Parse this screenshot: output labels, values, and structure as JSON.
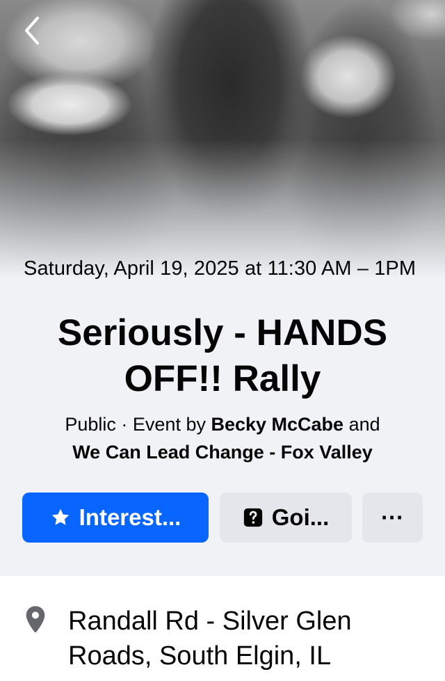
{
  "event": {
    "date_time": "Saturday, April 19, 2025 at 11:30 AM – 1PM",
    "title": "Seriously - HANDS OFF!! Rally",
    "privacy": "Public",
    "separator": " · ",
    "event_by_prefix": "Event by ",
    "host_1": "Becky McCabe",
    "and_word": " and ",
    "host_2": "We Can Lead Change - Fox Valley"
  },
  "actions": {
    "interested_label": "Interest...",
    "going_label": "Goi...",
    "more_label": "···"
  },
  "details": {
    "location": "Randall Rd - Silver Glen Roads, South Elgin, IL"
  },
  "icons": {
    "back": "chevron-left-icon",
    "interested": "star-icon",
    "going": "question-box-icon",
    "location": "map-pin-icon"
  },
  "colors": {
    "primary_blue": "#0866ff",
    "secondary_button": "#e4e6eb",
    "background": "#f0f2f5",
    "text": "#050505",
    "icon_gray": "#65676b"
  }
}
